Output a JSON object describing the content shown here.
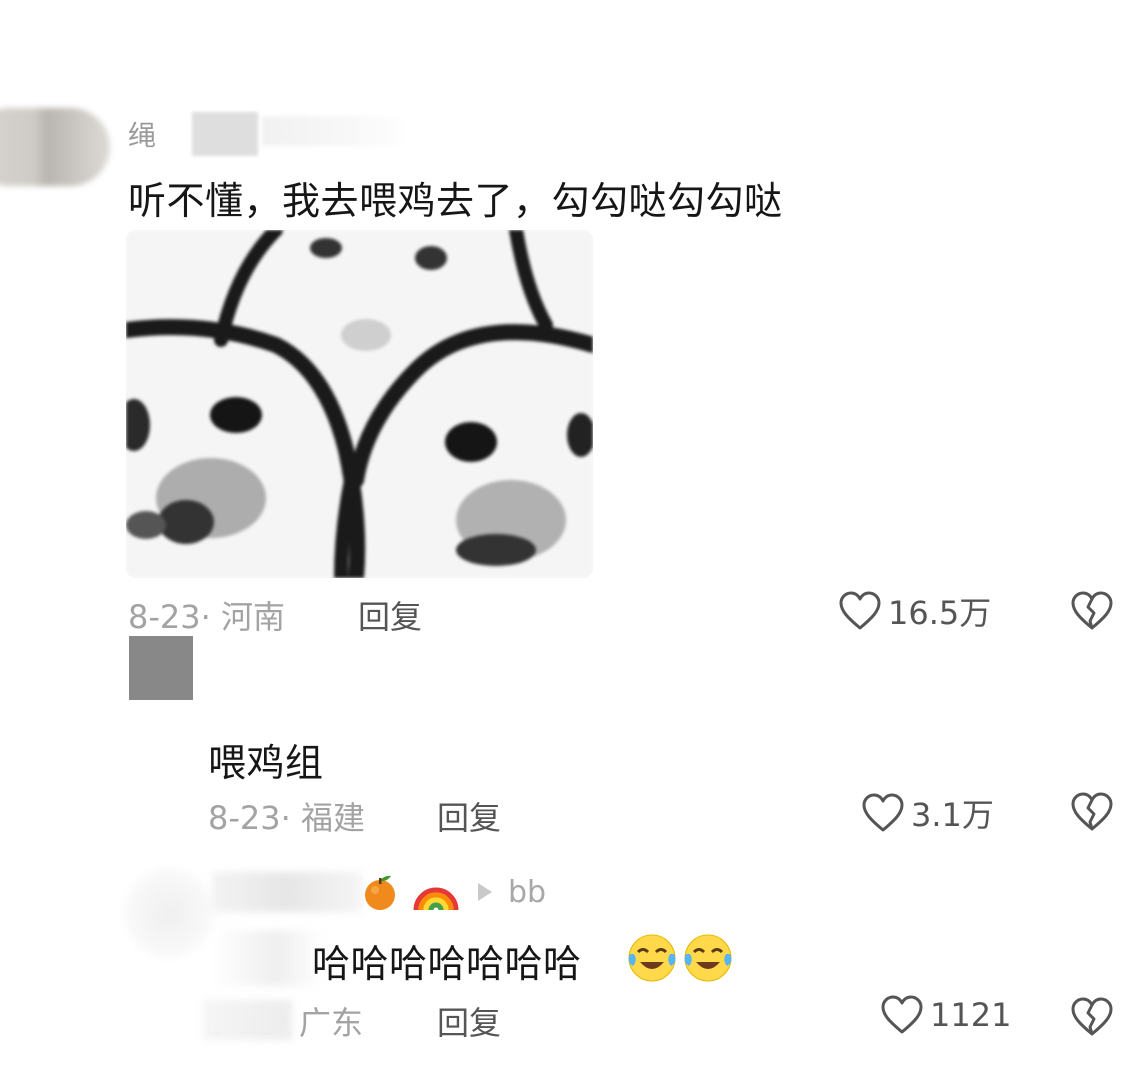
{
  "comment": {
    "author_visible": "绳",
    "text": "听不懂，我去喂鸡去了，勾勾哒勾勾哒",
    "date_location": "8-23· 河南",
    "reply_label": "回复",
    "likes": "16.5万",
    "image_icon": "meme-sticker-image"
  },
  "replies": [
    {
      "text": "喂鸡组",
      "date_location": "8-23· 福建",
      "reply_label": "回复",
      "likes": "3.1万"
    },
    {
      "badges": [
        "tangerine-emoji",
        "rainbow-emoji",
        "play-arrow-icon"
      ],
      "reply_to": "bb",
      "text": "哈哈哈哈哈哈哈",
      "emojis": [
        "tears-of-joy-emoji",
        "tears-of-joy-emoji"
      ],
      "date_location": "8-23· 广东",
      "reply_label": "回复",
      "likes": "1121"
    }
  ],
  "icons": {
    "like": "heart-outline-icon",
    "dislike": "broken-heart-icon"
  },
  "colors": {
    "primary_text": "#161616",
    "meta_text": "#a3a3a3",
    "action_text": "#555555"
  }
}
